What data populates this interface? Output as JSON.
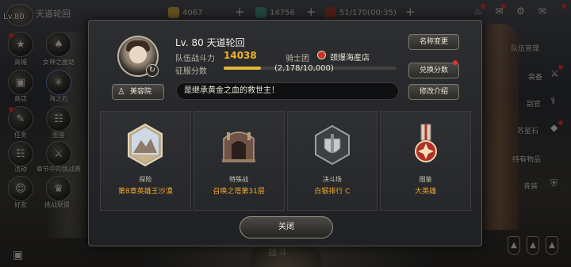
{
  "hud": {
    "level_label": "Lv.80",
    "player_name": "天道轮回",
    "gold": "4067",
    "gems": "14756",
    "stamina": "51/170(00:35)",
    "left_menu": [
      {
        "label": "商城"
      },
      {
        "label": "女神之援助"
      },
      {
        "label": "商店"
      },
      {
        "label": "海之石"
      },
      {
        "label": "任务"
      },
      {
        "label": "图鉴"
      },
      {
        "label": "活动"
      },
      {
        "label": "章节中的挑战赛"
      },
      {
        "label": "好友"
      },
      {
        "label": "挑战联盟"
      }
    ],
    "right_menu": [
      {
        "label": "队伍管理"
      },
      {
        "label": "装备"
      },
      {
        "label": "副官"
      },
      {
        "label": "苏星石"
      },
      {
        "label": "持有物品"
      },
      {
        "label": "背装"
      }
    ],
    "battle_label": "战斗"
  },
  "profile": {
    "level_name": "Lv. 80 天道轮回",
    "power_label": "队伍战斗力",
    "power_value": "14038",
    "guild_label": "骑士团",
    "guild_name": "颈爆海産店",
    "conquest_label": "征服分数",
    "conquest_value": "(2,178/10,000)",
    "conquest_progress": 0.2178,
    "beauty_button": "美容院",
    "motto": "是继承黄金之血的救世主！",
    "buttons": {
      "rename": "名称变更",
      "exchange": "兑换分数",
      "edit_intro": "修改介绍"
    },
    "cards": [
      {
        "title": "探险",
        "value": "第8章英雄王沙漠"
      },
      {
        "title": "特殊战",
        "value": "召唤之塔第31层"
      },
      {
        "title": "决斗场",
        "value": "白银排行 C"
      },
      {
        "title": "图鉴",
        "value": "大英雄"
      }
    ],
    "close_button": "关闭"
  },
  "colors": {
    "accent_gold": "#f0b429",
    "value_orange": "#f0a92a",
    "notify_red": "#e4332b"
  }
}
